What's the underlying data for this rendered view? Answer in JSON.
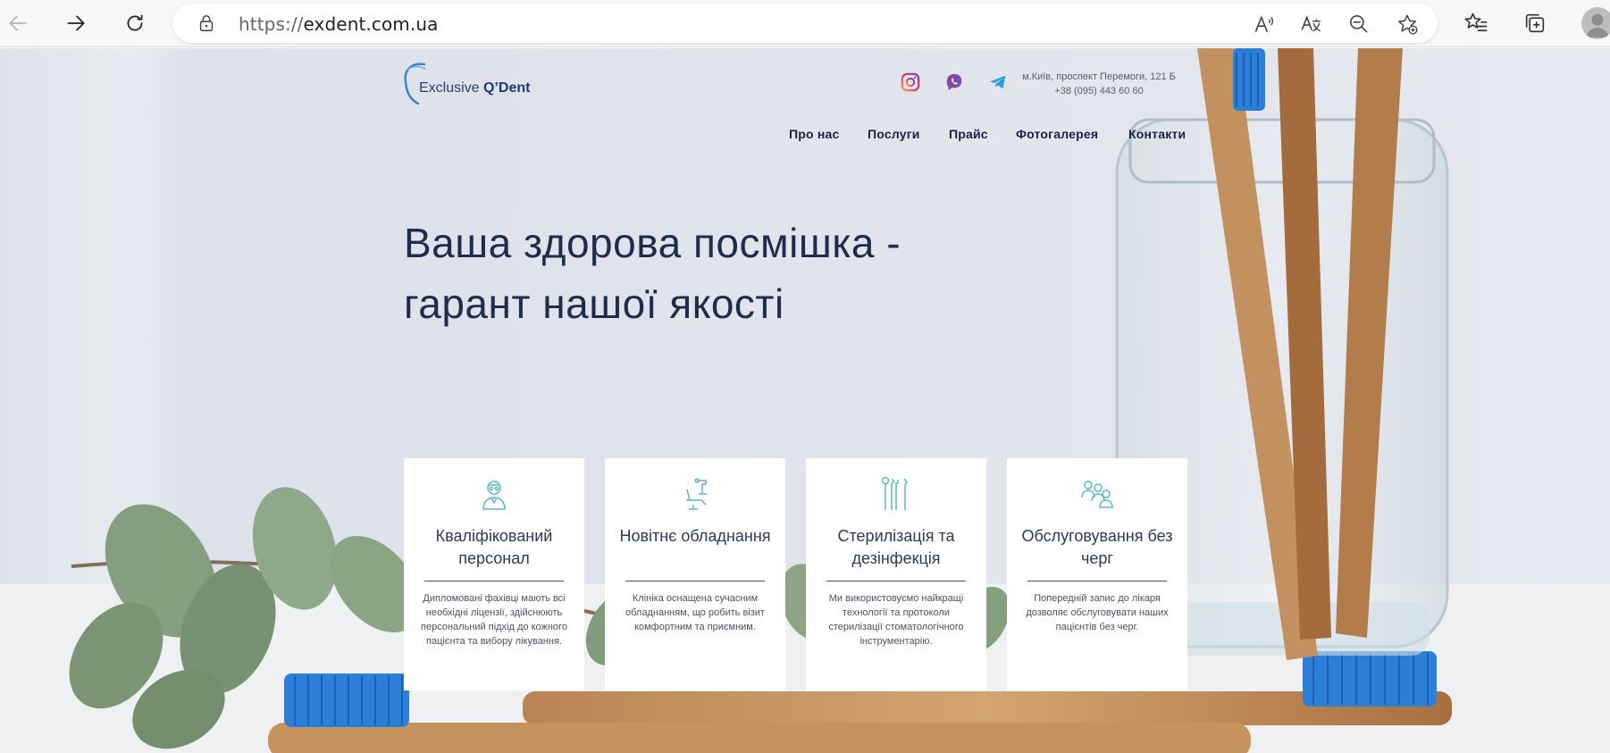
{
  "browser": {
    "url_scheme": "https://",
    "url_host": "exdent.com.ua",
    "icons": [
      "back-icon",
      "forward-icon",
      "refresh-icon",
      "lock-icon",
      "read-aloud-icon",
      "translate-icon",
      "zoom-out-icon",
      "add-favorite-icon",
      "favorites-icon",
      "collections-icon",
      "profile-icon"
    ]
  },
  "site": {
    "logo": {
      "name_regular": "Exclusive ",
      "name_bold": "Q’Dent"
    },
    "socials": [
      "instagram-icon",
      "viber-icon",
      "telegram-icon"
    ],
    "address": "м.Київ, проспект Перемоги, 121 Б",
    "phone": "+38 (095) 443 60 60",
    "nav": [
      "Про нас",
      "Послуги",
      "Прайс",
      "Фотогалерея",
      "Контакти"
    ],
    "headline_line1": "Ваша здорова посмішка -",
    "headline_line2": "гарант нашої якості",
    "cards": [
      {
        "icon": "doctor-icon",
        "title": "Кваліфікований персонал",
        "text": "Дипломовані фахівці мають всі необхідні ліцензії, здійснюють персональний підхід до кожного пацієнта та вибору лікування."
      },
      {
        "icon": "dental-chair-icon",
        "title": "Новітнє обладнання",
        "text": "Клініка оснащена сучасним обладнанням, що робить візит комфортним та приємним."
      },
      {
        "icon": "dental-tools-icon",
        "title": "Стерилізація та дезінфекція",
        "text": "Ми використовуємо найкращі технології та протоколи стерилізації стоматологічного інструментарію."
      },
      {
        "icon": "patients-group-icon",
        "title": "Обслуговування без черг",
        "text": "Попередній запис до лікаря дозволяє обслуговувати наших пацієнтів без черг."
      }
    ]
  },
  "colors": {
    "accent_teal": "#5bb8c4",
    "navy_text": "#1f2d4d",
    "brush_blue": "#2b7fd8"
  }
}
